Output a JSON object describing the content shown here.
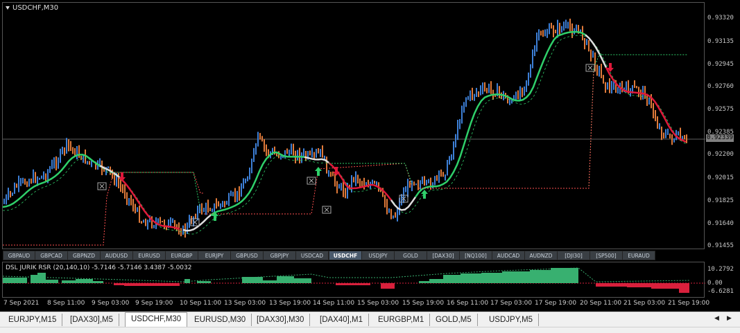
{
  "chart_title": "USDCHF,M30",
  "indicator_title": "DSL JURIK RSR (20,140,10) -5.7146 -5.7146 3.4387 -5.0032",
  "current_price": "0.92339",
  "price_axis": [
    "0.93320",
    "0.93135",
    "0.92945",
    "0.92760",
    "0.92575",
    "0.92385",
    "0.92200",
    "0.92015",
    "0.91825",
    "0.91640",
    "0.91455"
  ],
  "indicator_axis": [
    "10.2792",
    "0.00",
    "-6.6281"
  ],
  "time_axis": [
    "7 Sep 2021",
    "8 Sep 11:00",
    "9 Sep 03:00",
    "9 Sep 19:00",
    "10 Sep 11:00",
    "13 Sep 03:00",
    "13 Sep 19:00",
    "14 Sep 11:00",
    "15 Sep 03:00",
    "15 Sep 19:00",
    "16 Sep 11:00",
    "17 Sep 03:00",
    "17 Sep 19:00",
    "20 Sep 11:00",
    "21 Sep 03:00",
    "21 Sep 19:00"
  ],
  "symbol_buttons": [
    "GBPAUD",
    "GBPCAD",
    "GBPNZD",
    "AUDUSD",
    "EURUSD",
    "EURGBP",
    "EURJPY",
    "GBPUSD",
    "GBPJPY",
    "USDCAD",
    "USDCHF",
    "USDJPY",
    "GOLD",
    "[DAX30]",
    "[NQ100]",
    "AUDCAD",
    "AUDNZD",
    "[DJI30]",
    "[SP500]",
    "EURAUD"
  ],
  "active_symbol": "USDCHF",
  "tabs": [
    "EURJPY,M15",
    "[DAX30],M5",
    "USDCHF,M30",
    "EURUSD,M30",
    "[DAX30],M30",
    "[DAX40],M1",
    "EURGBP,M1",
    "GOLD,M5",
    "USDJPY,M5"
  ],
  "active_tab": "USDCHF,M30",
  "colors": {
    "bull": "#3d7fd6",
    "bear": "#e07a3a",
    "up_line": "#2fd06a",
    "down_line": "#e0183a",
    "hist_up": "#38b070",
    "hist_down": "#d8203c"
  },
  "icons": {
    "tab_prev": "chevron-left-icon",
    "tab_next": "chevron-right-icon",
    "buy_signal": "up-arrow-icon",
    "sell_signal": "down-arrow-icon",
    "cross_marker": "x-box-icon"
  }
}
